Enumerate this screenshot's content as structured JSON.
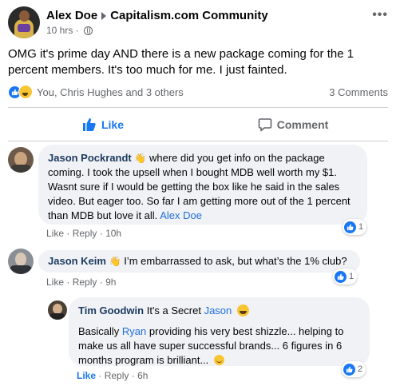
{
  "post": {
    "author": "Alex Doe",
    "group": "Capitalism.com Community",
    "time": "10 hrs ·",
    "body": "OMG it's prime day AND there is a new package coming for the 1 percent members. It's too much for me. I just fainted.",
    "reactions_text": "You, Chris Hughes and 3 others",
    "comments_count": "3 Comments"
  },
  "actions": {
    "like": "Like",
    "comment": "Comment"
  },
  "comments": [
    {
      "name": "Jason Pockrandt",
      "wave": "👋",
      "text": "where did you get info on the package coming. I took the upsell when I bought MDB well worth my $1. Wasnt sure if I would be getting the box like he said in the sales video. But eager too. So far I am getting more out of the 1 percent than MDB but love it all.",
      "mention": "Alex Doe",
      "like": "Like",
      "reply": "Reply",
      "time": "10h",
      "reaction_count": "1"
    },
    {
      "name": "Jason Keim",
      "wave": "👋",
      "text": "I’m embarrassed to ask, but what’s the 1% club?",
      "like": "Like",
      "reply": "Reply",
      "time": "9h",
      "reaction_count": "1"
    },
    {
      "name": "Tim Goodwin",
      "text_pre": "It's a Secret",
      "mention": "Jason",
      "text2_pre": "Basically",
      "mention2": "Ryan",
      "text2_post": "providing his very best shizzle... helping to make us all have super successful brands... 6 figures in 6 months program is brilliant...",
      "like": "Like",
      "reply": "Reply",
      "time": "6h",
      "reaction_count": "2"
    }
  ],
  "separator": "·",
  "colors": {
    "accent": "#1877f2",
    "bubble": "#f0f2f5",
    "muted": "#65676b"
  }
}
